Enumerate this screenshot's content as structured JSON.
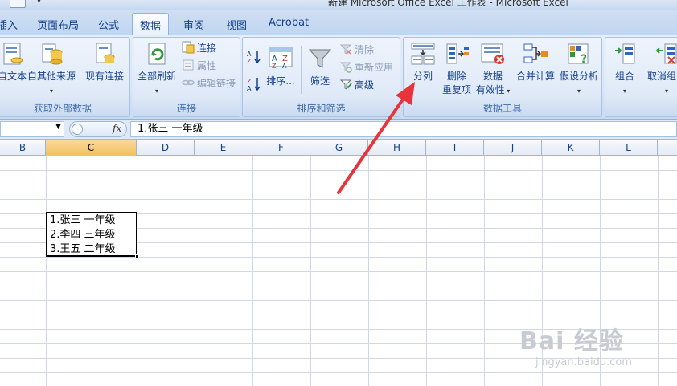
{
  "window": {
    "title": "新建 Microsoft Office Excel 工作表 - Microsoft Excel"
  },
  "tabs": [
    {
      "label": "插入",
      "active": false
    },
    {
      "label": "页面布局",
      "active": false
    },
    {
      "label": "公式",
      "active": false
    },
    {
      "label": "数据",
      "active": true
    },
    {
      "label": "审阅",
      "active": false
    },
    {
      "label": "视图",
      "active": false
    },
    {
      "label": "Acrobat",
      "active": false
    }
  ],
  "ribbon": {
    "external": {
      "label": "获取外部数据",
      "from_text": "自文本",
      "other_sources": "自其他来源",
      "existing": "现有连接"
    },
    "connections": {
      "label": "连接",
      "refresh_all": "全部刷新",
      "connections": "连接",
      "properties": "属性",
      "edit_links": "编辑链接"
    },
    "sort_filter": {
      "label": "排序和筛选",
      "sort": "排序...",
      "filter": "筛选",
      "clear": "清除",
      "reapply": "重新应用",
      "advanced": "高级"
    },
    "data_tools": {
      "label": "数据工具",
      "text_to_columns": "分列",
      "remove_dup_1": "删除",
      "remove_dup_2": "重复项",
      "validation_1": "数据",
      "validation_2": "有效性",
      "consolidate": "合并计算",
      "whatif": "假设分析"
    },
    "outline": {
      "group": "组合",
      "ungroup": "取消组合"
    }
  },
  "formula_bar": {
    "name_box": "",
    "fx": "fx",
    "value": "1.张三  一年级"
  },
  "columns": [
    "B",
    "C",
    "D",
    "E",
    "F",
    "G",
    "H",
    "I",
    "J",
    "K",
    "L"
  ],
  "selected_column": "C",
  "cell_lines": [
    "1.张三  一年级",
    "2.李四  三年级",
    "3.王五  二年级"
  ],
  "watermark": {
    "main": "Bai 经验",
    "sub": "jingyan.baidu.com"
  },
  "colors": {
    "accent_arrow": "#e8333a",
    "selection_header": "#f1c15f"
  }
}
